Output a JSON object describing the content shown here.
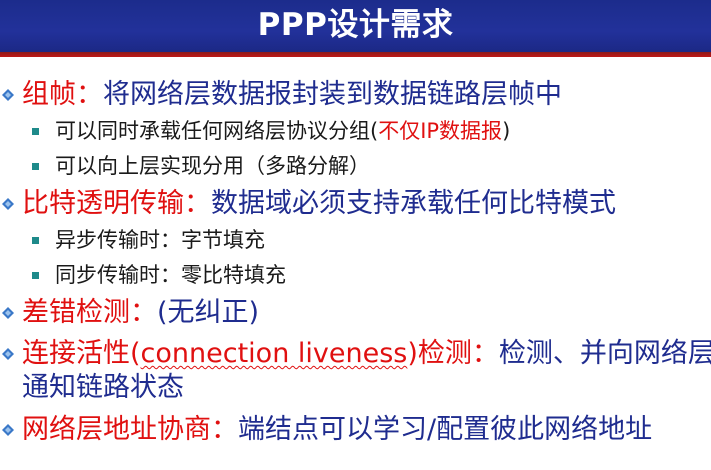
{
  "slide": {
    "title": "PPP设计需求"
  },
  "bullets": [
    {
      "head": "组帧：",
      "body": "将网络层数据报封装到数据链路层帧中",
      "subs": [
        {
          "text": "可以同时承载任何网络层协议分组(",
          "red": "不仅IP数据报",
          "tail": ")"
        },
        {
          "text": "可以向上层实现分用（多路分解）"
        }
      ]
    },
    {
      "head": "比特透明传输：",
      "body": "数据域必须支持承载任何比特模式",
      "subs": [
        {
          "text": "异步传输时：字节填充"
        },
        {
          "text": "同步传输时：零比特填充"
        }
      ]
    },
    {
      "head": "差错检测：",
      "body": "(无纠正)"
    },
    {
      "head_part1": "连接活性(",
      "head_part2": "connection liveness",
      "head_part3": ")检测：",
      "body": "检测、并向网络层",
      "body_line2": "通知链路状态"
    },
    {
      "head": "网络层地址协商：",
      "body": "端结点可以学习/配置彼此网络地址"
    }
  ]
}
